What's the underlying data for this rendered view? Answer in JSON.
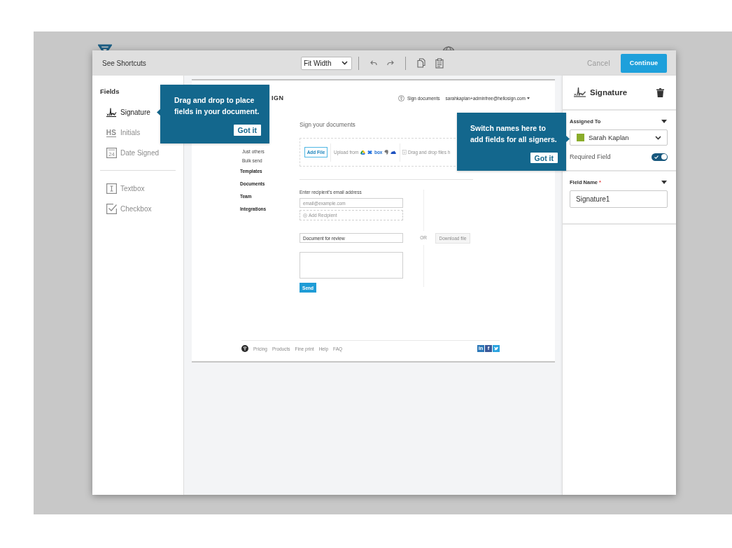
{
  "toolbar": {
    "shortcuts": "See Shortcuts",
    "zoom": "Fit Width",
    "cancel": "Cancel",
    "continue": "Continue"
  },
  "sidebar": {
    "heading": "Fields",
    "sections": [
      {
        "items": [
          {
            "kind": "signature",
            "label": "Signature",
            "selected": true
          },
          {
            "kind": "initials",
            "label": "Initials",
            "icon_text": "HS",
            "selected": false
          },
          {
            "kind": "date",
            "label": "Date Signed",
            "icon_text": "24",
            "selected": false
          }
        ]
      },
      {
        "items": [
          {
            "kind": "textbox",
            "label": "Textbox",
            "selected": false
          },
          {
            "kind": "checkbox",
            "label": "Checkbox",
            "selected": false
          }
        ]
      }
    ]
  },
  "document": {
    "logo_text": "IGN",
    "header": {
      "link": "Sign documents",
      "account": "sarahkaplan+adminfree@hellosign.com"
    },
    "nav": {
      "sub_items": [
        "Just others",
        "Bulk send"
      ],
      "items": [
        "Templates",
        "Documents",
        "Team",
        "Integrations"
      ]
    },
    "heading": "Sign your documents",
    "upload": {
      "add_file": "Add File",
      "upload_from": "Upload from",
      "sources": [
        {
          "kind": "drive"
        },
        {
          "kind": "dropbox"
        },
        {
          "kind": "box",
          "text": "box"
        },
        {
          "kind": "evernote"
        },
        {
          "kind": "onedrive"
        }
      ],
      "drop_hint": "Drag and drop files h"
    },
    "recipient": {
      "label": "Enter recipient's email address",
      "email_placeholder": "email@example.com",
      "add_recipient": "Add Recipient",
      "title_value": "Document for review",
      "send": "Send"
    },
    "or": "OR",
    "download": {
      "label": "Download file",
      "disabled": true
    },
    "footer": {
      "links": [
        "Pricing",
        "Products",
        "Fine print",
        "Help",
        "FAQ"
      ],
      "social": [
        {
          "kind": "letter",
          "text": "in",
          "color": "#2c78b8"
        },
        {
          "kind": "letter",
          "text": "f",
          "color": "#3b5a9a"
        },
        {
          "kind": "bird",
          "color": "#2ba3df"
        }
      ]
    }
  },
  "field_panel": {
    "title": "Signature",
    "assigned_to": {
      "label": "Assigned To",
      "expanded": true,
      "signer": {
        "name": "Sarah Kaplan",
        "color": "#8aac2b"
      }
    },
    "required": {
      "label": "Required Field",
      "on": true
    },
    "field_name": {
      "label": "Field Name",
      "expanded": true,
      "required_mark": "*",
      "value": "Signature1"
    }
  },
  "tooltips": [
    {
      "kind": "pointer_left",
      "text": "Drag and drop to place fields in your document.",
      "button": "Got it"
    },
    {
      "kind": "pointer_right",
      "text": "Switch names here to add fields for all signers.",
      "button": "Got it"
    }
  ]
}
